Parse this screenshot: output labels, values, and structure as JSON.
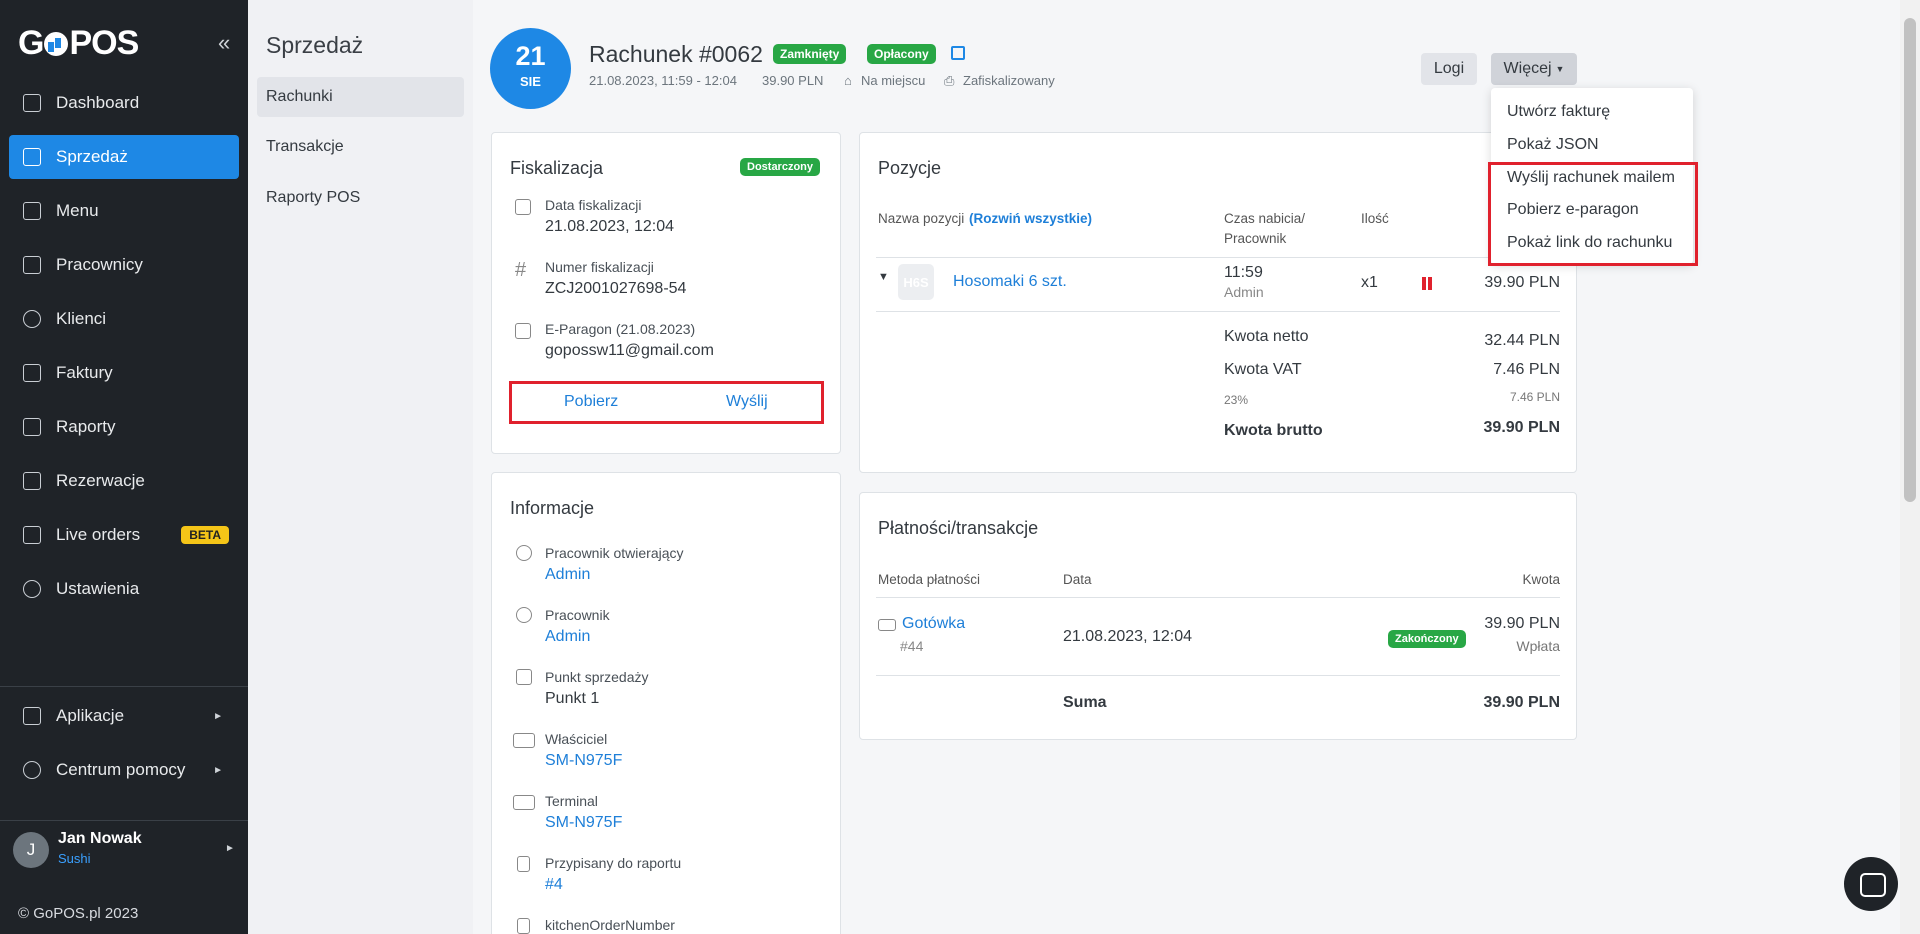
{
  "sidebar": {
    "logo": "GoPOS",
    "items": [
      {
        "label": "Dashboard"
      },
      {
        "label": "Sprzedaż"
      },
      {
        "label": "Menu"
      },
      {
        "label": "Pracownicy"
      },
      {
        "label": "Klienci"
      },
      {
        "label": "Faktury"
      },
      {
        "label": "Raporty"
      },
      {
        "label": "Rezerwacje"
      },
      {
        "label": "Live orders",
        "badge": "BETA"
      },
      {
        "label": "Ustawienia"
      }
    ],
    "bottom_items": [
      {
        "label": "Aplikacje"
      },
      {
        "label": "Centrum pomocy"
      }
    ],
    "user": {
      "initial": "J",
      "name": "Jan Nowak",
      "org": "Sushi"
    },
    "copyright": "© GoPOS.pl 2023"
  },
  "subnav": {
    "title": "Sprzedaż",
    "items": [
      "Rachunki",
      "Transakcje",
      "Raporty POS"
    ]
  },
  "header": {
    "day": "21",
    "month": "SIE",
    "title": "Rachunek #0062",
    "badge_closed": "Zamknięty",
    "badge_paid": "Opłacony",
    "datetime": "21.08.2023, 11:59 - 12:04",
    "amount": "39.90 PLN",
    "place": "Na miejscu",
    "fiscal": "Zafiskalizowany",
    "btn_logs": "Logi",
    "btn_more": "Więcej"
  },
  "dropdown": {
    "items": [
      "Utwórz fakturę",
      "Pokaż JSON",
      "Wyślij rachunek mailem",
      "Pobierz e-paragon",
      "Pokaż link do rachunku"
    ]
  },
  "fiscal": {
    "title": "Fiskalizacja",
    "badge": "Dostarczony",
    "date_label": "Data fiskalizacji",
    "date_value": "21.08.2023, 12:04",
    "number_label": "Numer fiskalizacji",
    "number_value": "ZCJ2001027698-54",
    "eparagon_label": "E-Paragon (21.08.2023)",
    "eparagon_value": "gopossw11@gmail.com",
    "btn_download": "Pobierz",
    "btn_send": "Wyślij"
  },
  "info": {
    "title": "Informacje",
    "rows": [
      {
        "label": "Pracownik otwierający",
        "value": "Admin"
      },
      {
        "label": "Pracownik",
        "value": "Admin"
      },
      {
        "label": "Punkt sprzedaży",
        "value": "Punkt 1"
      },
      {
        "label": "Właściciel",
        "value": "SM-N975F"
      },
      {
        "label": "Terminal",
        "value": "SM-N975F"
      },
      {
        "label": "Przypisany do raportu",
        "value": "#4"
      },
      {
        "label": "kitchenOrderNumber",
        "value": ""
      }
    ]
  },
  "positions": {
    "title": "Pozycje",
    "col_name": "Nazwa pozycji",
    "expand_all": "(Rozwiń wszystkie)",
    "col_time_1": "Czas nabicia/",
    "col_time_2": "Pracownik",
    "col_qty": "Ilość",
    "item": {
      "thumb": "H6S",
      "name": "Hosomaki 6 szt.",
      "time": "11:59",
      "employee": "Admin",
      "qty": "x1",
      "price": "39.90 PLN"
    },
    "net_label": "Kwota netto",
    "net_value": "32.44 PLN",
    "vat_label": "Kwota VAT",
    "vat_value": "7.46 PLN",
    "vat_rate_label": "23%",
    "vat_rate_value": "7.46 PLN",
    "gross_label": "Kwota brutto",
    "gross_value": "39.90 PLN"
  },
  "payments": {
    "title": "Płatności/transakcje",
    "col_method": "Metoda płatności",
    "col_date": "Data",
    "col_amount": "Kwota",
    "row": {
      "method": "Gotówka",
      "id": "#44",
      "date": "21.08.2023, 12:04",
      "status": "Zakończony",
      "amount": "39.90 PLN",
      "type": "Wpłata"
    },
    "sum_label": "Suma",
    "sum_value": "39.90 PLN"
  },
  "colors": {
    "accent": "#1e88e5",
    "success": "#28a745",
    "highlight": "#e0212d",
    "sidebar_bg": "#1f2328"
  }
}
